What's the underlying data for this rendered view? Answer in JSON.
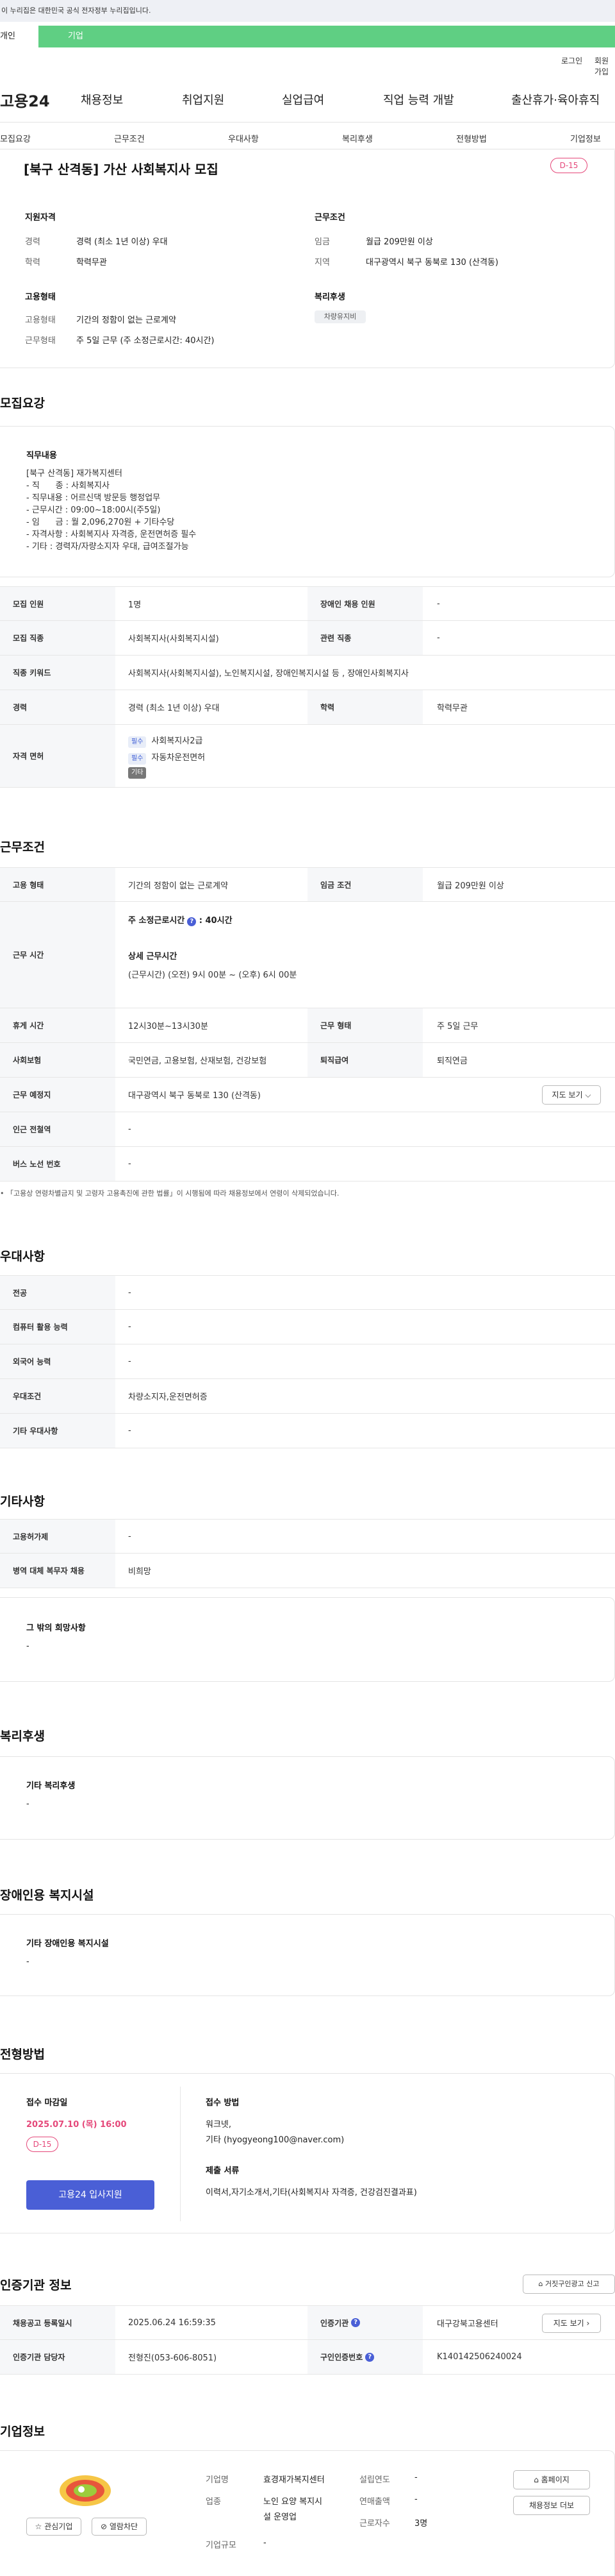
{
  "banner": {
    "text": "이 누리집은 대한민국 공식 전자정부 누리집입니다."
  },
  "top_tabs": {
    "personal": "개인",
    "company": "기업"
  },
  "util": {
    "login": "로그인",
    "join": "회원가입"
  },
  "gnb": {
    "logo": "고용24",
    "menus": [
      "채용정보",
      "취업지원",
      "실업급여",
      "직업 능력 개발",
      "출산휴가·육아휴직"
    ]
  },
  "anchors": [
    "모집요강",
    "근무조건",
    "우대사항",
    "복리후생",
    "전형방법",
    "기업정보"
  ],
  "summary": {
    "title": "[북구 산격동] 가산 사회복지사 모집",
    "dday": "D-15",
    "qual_title": "지원자격",
    "career_label": "경력",
    "career_value": "경력 (최소 1년 이상) 우대",
    "edu_label": "학력",
    "edu_value": "학력무관",
    "work_title": "근무조건",
    "wage_label": "임금",
    "wage_value": "월급 209만원 이상",
    "region_label": "지역",
    "region_value": "대구광역시 북구 동북로 130 (산격동)",
    "emp_title": "고용형태",
    "emp_label": "고용형태",
    "emp_value": "기간의 정함이 없는 근로계약",
    "shift_label": "근무형태",
    "shift_value": "주 5일 근무 (주 소정근로시간: 40시간)",
    "welfare_title": "복리후생",
    "welfare_chip": "차량유지비"
  },
  "recruit": {
    "section_title": "모집요강",
    "job_title": "직무내용",
    "job_text": "[북구 산격동] 재가복지센터\n- 직      종 : 사회복지사\n- 직무내용 : 어르신댁 방문등 행정업무\n- 근무시간 : 09:00~18:00시(주5일)\n- 임      금 : 월 2,096,270원 + 기타수당\n- 자격사항 : 사회복지사 자격증, 운전면허증 필수\n- 기타 : 경력자/자량소지자 우대, 급여조절가능",
    "rows": {
      "count_label": "모집 인원",
      "count_value": "1명",
      "disabled_label": "장애인 채용 인원",
      "disabled_value": "-",
      "job_label": "모집 직종",
      "job_value": "사회복지사(사회복지시설)",
      "related_label": "관련 직종",
      "related_value": "-",
      "keyword_label": "직종 키워드",
      "keyword_value": "사회복지사(사회복지시설), 노인복지시설, 장애인복지시설 등 , 장애인사회복지사",
      "career_label": "경력",
      "career_value": "경력 (최소 1년 이상) 우대",
      "edu_label": "학력",
      "edu_value": "학력무관",
      "license_label": "자격 면허",
      "license1_tag": "필수",
      "license1": "사회복지사2급",
      "license2_tag": "필수",
      "license2": "자동차운전면허",
      "license_tag3": "기타"
    }
  },
  "work": {
    "section_title": "근무조건",
    "emp_label": "고용 형태",
    "emp_value": "기간의 정함이 없는 근로계약",
    "wage_label": "임금 조건",
    "wage_value": "월급 209만원 이상",
    "time_label": "근무 시간",
    "weekly_label": "주 소정근로시간",
    "weekly_value": "40시간",
    "detail_label": "상세 근무시간",
    "detail_value": "(근무시간) (오전) 9시 00분 ~ (오후) 6시 00분",
    "rest_label": "휴게 시간",
    "rest_value": "12시30분~13시30분",
    "shift_label": "근무 형태",
    "shift_value": "주 5일 근무",
    "insurance_label": "사회보험",
    "insurance_value": "국민연금, 고용보험, 산재보험, 건강보험",
    "retire_label": "퇴직급여",
    "retire_value": "퇴직연금",
    "place_label": "근무 예정지",
    "place_value": "대구광역시 북구 동북로 130 (산격동)",
    "map_button": "지도 보기",
    "station_label": "인근 전철역",
    "station_value": "-",
    "bus_label": "버스 노선 번호",
    "bus_value": "-",
    "note": "「고용상 연령차별금지 및 고령자 고용촉진에 관한 법률」이 시행됨에 따라 채용정보에서 연령이 삭제되었습니다."
  },
  "pref": {
    "section_title": "우대사항",
    "major_label": "전공",
    "major_value": "-",
    "computer_label": "컴퓨터 활용 능력",
    "computer_value": "-",
    "language_label": "외국어 능력",
    "language_value": "-",
    "cond_label": "우대조건",
    "cond_value": "차량소지자,운전면허증",
    "other_label": "기타 우대사항",
    "other_value": "-"
  },
  "etc": {
    "section_title": "기타사항",
    "bonus_label": "고용허가제",
    "bonus_value": "-",
    "military_label": "병역 대체 복무자 채용",
    "military_value": "비희망",
    "wish_title": "그 밖의 희망사항",
    "wish_value": "-"
  },
  "welfare": {
    "section_title": "복리후생",
    "box_title": "기타 복리후생",
    "box_value": "-"
  },
  "facility": {
    "section_title": "장애인용 복지시설",
    "box_title": "기타 장애인용 복지시설",
    "box_value": "-"
  },
  "process": {
    "section_title": "전형방법",
    "deadline_label": "접수 마감일",
    "deadline_value": "2025.07.10 (목) 16:00",
    "dday": "D-15",
    "apply_button": "고용24 입사지원",
    "method_label": "접수 방법",
    "method_value1": "워크넷,",
    "method_value2": "기타 (hyogyeong100@naver.com)",
    "docs_label": "제출 서류",
    "docs_value": "이력서,자기소개서,기타(사회복지사 자격증, 건강검진결과표)"
  },
  "agency": {
    "section_title": "인증기관 정보",
    "report_button": "거짓구인광고 신고",
    "date_label": "채용공고 등록일시",
    "date_value": "2025.06.24 16:59:35",
    "agency_label": "인증기관",
    "agency_value": "대구강북고용센터",
    "map_button": "지도 보기",
    "manager_label": "인증기관 담당자",
    "manager_value": "전형진(053-606-8051)",
    "cert_label": "구인인증번호",
    "cert_value": "K140142506240024"
  },
  "company": {
    "section_title": "기업정보",
    "interest_button": "관심기업",
    "block_button": "열람차단",
    "name_label": "기업명",
    "name_value": "효경재가복지센터",
    "industry_label": "업종",
    "industry_value1": "노인 요양 복지시",
    "industry_value2": "설 운영업",
    "size_label": "기업규모",
    "size_value": "-",
    "founded_label": "설립연도",
    "founded_value": "-",
    "sales_label": "연매출액",
    "sales_value": "-",
    "employees_label": "근로자수",
    "employees_value": "3명",
    "homepage_button": "홈페이지",
    "jobs_button": "채용정보 더보"
  }
}
